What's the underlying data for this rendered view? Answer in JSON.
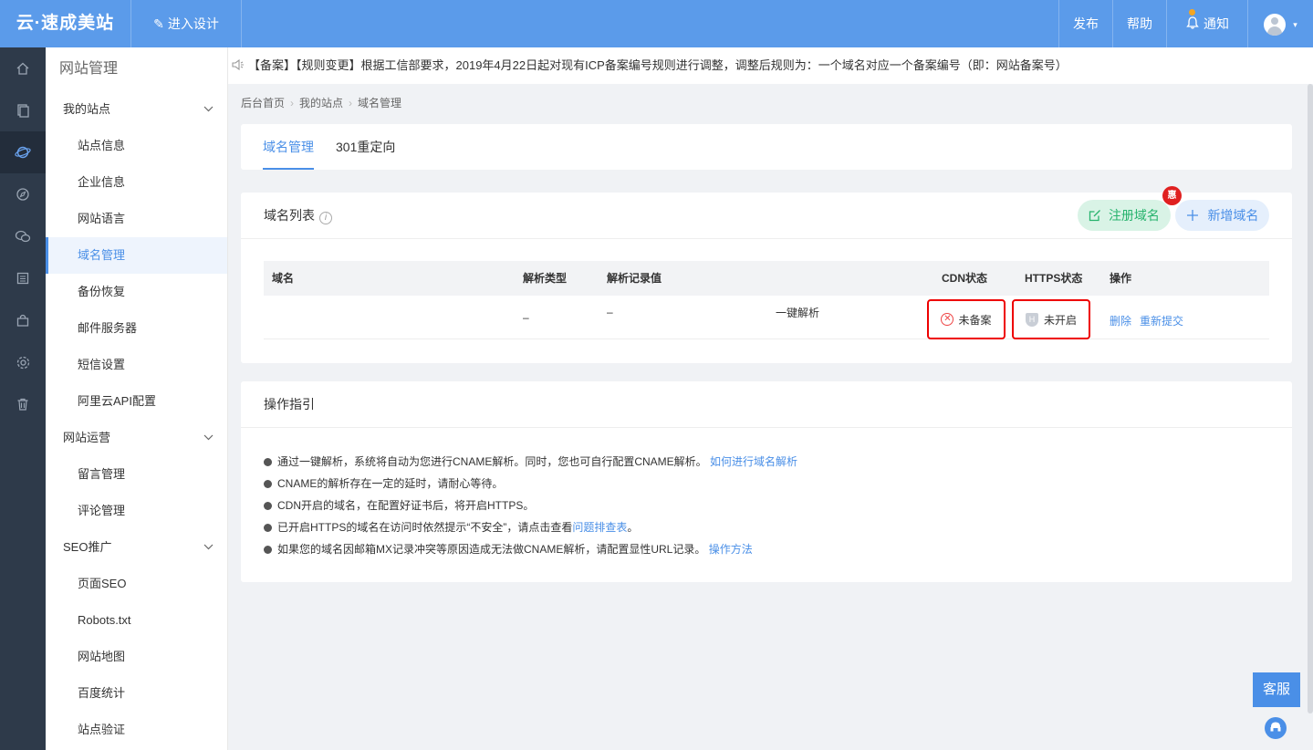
{
  "topbar": {
    "brand": "云·速成美站",
    "design_label": "进入设计",
    "publish": "发布",
    "help": "帮助",
    "notify": "通知",
    "caret": "▾"
  },
  "rail": {
    "icons": [
      "home-icon",
      "pages-icon",
      "globe-icon",
      "compass-icon",
      "chat-icon",
      "list-icon",
      "shop-icon",
      "gear-icon",
      "trash-icon"
    ]
  },
  "menu": {
    "title": "网站管理",
    "groups": [
      {
        "label": "我的站点",
        "items": [
          "站点信息",
          "企业信息",
          "网站语言",
          "域名管理",
          "备份恢复",
          "邮件服务器",
          "短信设置",
          "阿里云API配置"
        ]
      },
      {
        "label": "网站运营",
        "items": [
          "留言管理",
          "评论管理"
        ]
      },
      {
        "label": "SEO推广",
        "items": [
          "页面SEO",
          "Robots.txt",
          "网站地图",
          "百度统计",
          "站点验证"
        ]
      }
    ]
  },
  "notice": "【备案】【规则变更】根据工信部要求，2019年4月22日起对现有ICP备案编号规则进行调整，调整后规则为：一个域名对应一个备案编号（即：网站备案号）",
  "breadcrumb": [
    "后台首页",
    "我的站点",
    "域名管理"
  ],
  "tabs": [
    "域名管理",
    "301重定向"
  ],
  "domain_list": {
    "title": "域名列表",
    "info_icon": "i",
    "register_btn": "注册域名",
    "add_btn": "新增域名",
    "badge": "惠",
    "headers": [
      "域名",
      "解析类型",
      "解析记录值",
      "CDN状态",
      "HTTPS状态",
      "操作"
    ],
    "row": {
      "domain": "",
      "type": "–",
      "value": "–",
      "one_click": "一键解析",
      "cdn": "未备案",
      "https_icon": "H",
      "https": "未开启",
      "delete": "删除",
      "resubmit": "重新提交"
    }
  },
  "guide": {
    "title": "操作指引",
    "items": [
      {
        "text": "通过一键解析，系统将自动为您进行CNAME解析。同时，您也可自行配置CNAME解析。",
        "link": "如何进行域名解析"
      },
      {
        "text": "CNAME的解析存在一定的延时，请耐心等待。",
        "link": ""
      },
      {
        "text": "CDN开启的域名，在配置好证书后，将开启HTTPS。",
        "link": ""
      },
      {
        "text": "已开启HTTPS的域名在访问时依然提示“不安全”，请点击查看",
        "link": "问题排查表",
        "suffix": "。"
      },
      {
        "text": "如果您的域名因邮箱MX记录冲突等原因造成无法做CNAME解析，请配置显性URL记录。",
        "link": "操作方法"
      }
    ]
  },
  "service": {
    "label": "客服"
  },
  "colors": {
    "primary": "#5b9bea",
    "link": "#4a8fe7",
    "green": "#27b36d",
    "rail_bg": "#2e3a4a",
    "highlight_border": "#e00000"
  }
}
